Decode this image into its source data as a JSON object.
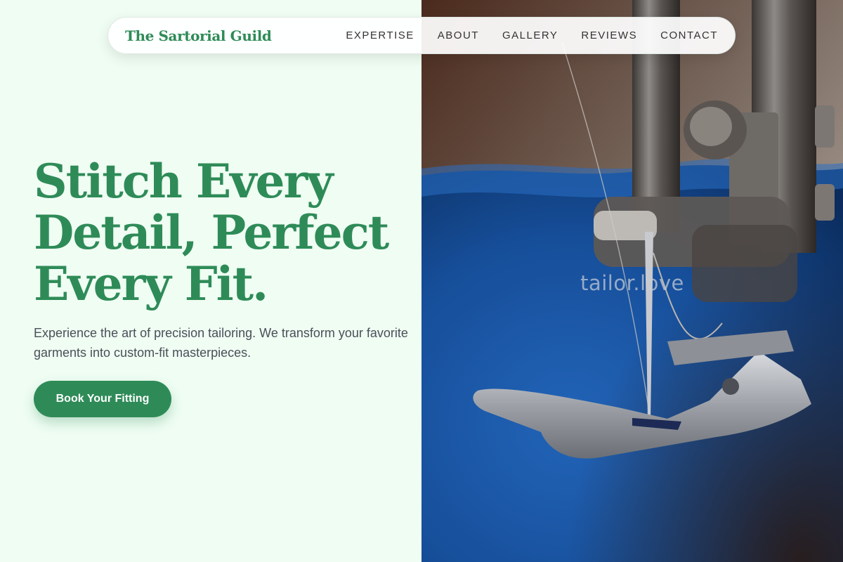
{
  "nav": {
    "brand": "The Sartorial Guild",
    "links": [
      "EXPERTISE",
      "ABOUT",
      "GALLERY",
      "REVIEWS",
      "CONTACT"
    ]
  },
  "hero": {
    "title": "Stitch Every Detail, Perfect Every Fit.",
    "description": "Experience the art of precision tailoring. We transform your favorite garments into custom-fit masterpieces.",
    "cta_label": "Book Your Fitting"
  },
  "image": {
    "watermark": "tailor.love",
    "subject": "sewing-machine-photo"
  },
  "colors": {
    "accent": "#2e8b57",
    "background": "#effdf3",
    "text": "#4b4f58",
    "fabric": "#1a4f9c"
  }
}
